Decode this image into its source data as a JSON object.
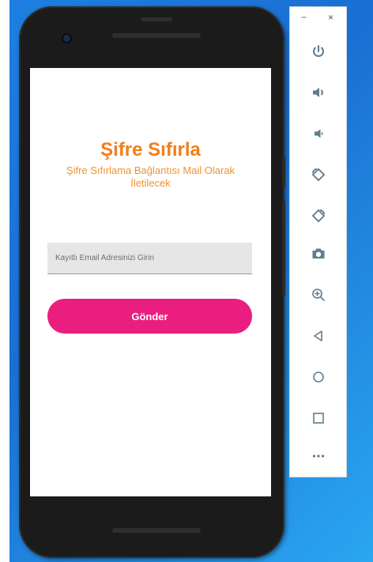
{
  "app": {
    "title": "Şifre Sıfırla",
    "subtitle": "Şifre Sıfırlama Bağlantısı Mail Olarak İletilecek",
    "email_placeholder": "Kayıtlı Email Adresinizi Girin",
    "email_value": "",
    "send_label": "Gönder"
  },
  "emulator_toolbar": {
    "minimize_label": "−",
    "close_label": "×",
    "buttons": [
      {
        "icon": "power-icon"
      },
      {
        "icon": "volume-up-icon"
      },
      {
        "icon": "volume-down-icon"
      },
      {
        "icon": "rotate-left-icon"
      },
      {
        "icon": "rotate-right-icon"
      },
      {
        "icon": "camera-icon"
      },
      {
        "icon": "zoom-in-icon"
      },
      {
        "icon": "back-icon"
      },
      {
        "icon": "home-icon"
      },
      {
        "icon": "overview-icon"
      },
      {
        "icon": "more-icon"
      }
    ]
  },
  "colors": {
    "title": "#f07f1a",
    "subtitle": "#f3922e",
    "button": "#e91e7e",
    "toolbar_icon": "#5f7d8c",
    "desktop": "#1e7fe0"
  }
}
